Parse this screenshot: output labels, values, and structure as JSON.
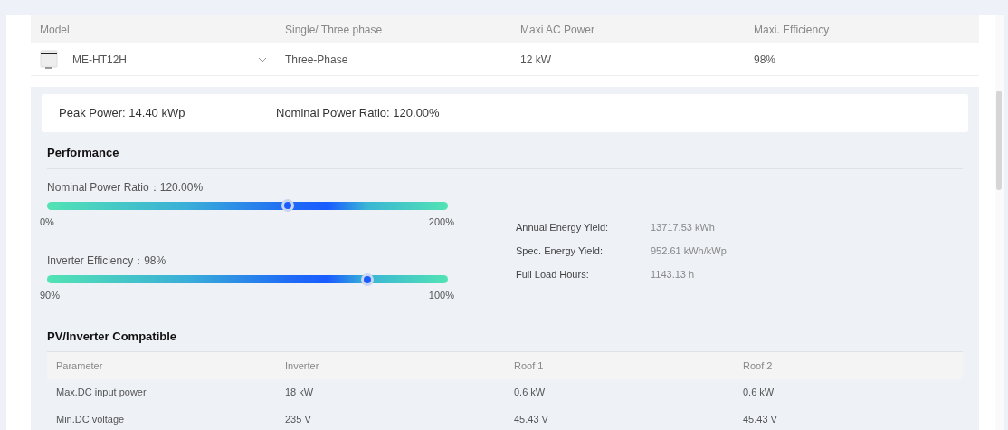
{
  "model_table": {
    "columns": [
      "Model",
      "Single/ Three phase",
      "Maxi AC Power",
      "Maxi. Efficiency"
    ],
    "row": {
      "model": "ME-HT12H",
      "phase": "Three-Phase",
      "ac_power": "12 kW",
      "efficiency": "98%"
    }
  },
  "summary": {
    "peak_power": "Peak Power: 14.40 kWp",
    "nominal_ratio": "Nominal Power Ratio: 120.00%"
  },
  "performance": {
    "title": "Performance",
    "sliders": [
      {
        "label": "Nominal Power Ratio：120.00%",
        "level": 0.6,
        "min": "0%",
        "max": "200%"
      },
      {
        "label": "Inverter Efficiency：98%",
        "level": 0.8,
        "min": "90%",
        "max": "100%"
      }
    ],
    "stats": [
      {
        "label": "Annual Energy Yield:",
        "value": "13717.53 kWh"
      },
      {
        "label": "Spec. Energy Yield:",
        "value": "952.61 kWh/kWp"
      },
      {
        "label": "Full Load Hours:",
        "value": "1143.13 h"
      }
    ]
  },
  "compatibility": {
    "title": "PV/Inverter Compatible",
    "columns": [
      "Parameter",
      "Inverter",
      "Roof 1",
      "Roof 2"
    ],
    "rows": [
      [
        "Max.DC input power",
        "18 kW",
        "0.6 kW",
        "0.6 kW"
      ],
      [
        "Min.DC voltage",
        "235 V",
        "45.43 V",
        "45.43 V"
      ]
    ]
  }
}
